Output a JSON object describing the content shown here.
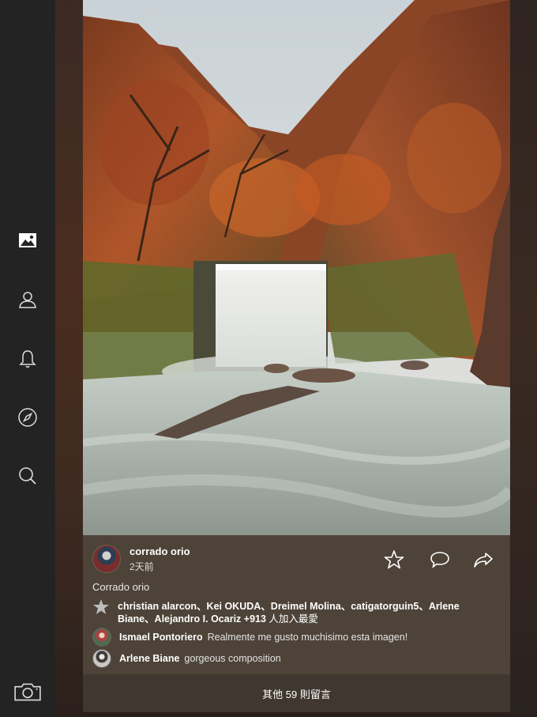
{
  "nav": {
    "items": [
      {
        "name": "photos",
        "icon": "image-icon",
        "active": true
      },
      {
        "name": "profile",
        "icon": "user-icon",
        "active": false
      },
      {
        "name": "notifications",
        "icon": "bell-icon",
        "active": false
      },
      {
        "name": "explore",
        "icon": "compass-icon",
        "active": false
      },
      {
        "name": "search",
        "icon": "search-icon",
        "active": false
      }
    ],
    "camera_icon": "camera-icon"
  },
  "post": {
    "author": "corrado orio",
    "time_ago": "2天前",
    "photo_title": "Corrado orio",
    "actions": [
      "star-icon",
      "comment-icon",
      "share-icon"
    ],
    "likes": {
      "names_prefix": "christian alarcon、Kei OKUDA、Dreimel Molina、catigatorguin5、Arlene Biane、Alejandro I. Ocariz",
      "more_count": "+913",
      "suffix": " 人加入最愛"
    },
    "comments": [
      {
        "author": "Ismael Pontoriero",
        "text": "Realmente me gusto muchisimo esta imagen!"
      },
      {
        "author": "Arlene Biane",
        "text": "gorgeous composition"
      }
    ],
    "more_comments_label": "其他 59 則留言"
  },
  "colors": {
    "rail": "#232323",
    "panel": "#4e443a",
    "text": "#ffffff"
  }
}
